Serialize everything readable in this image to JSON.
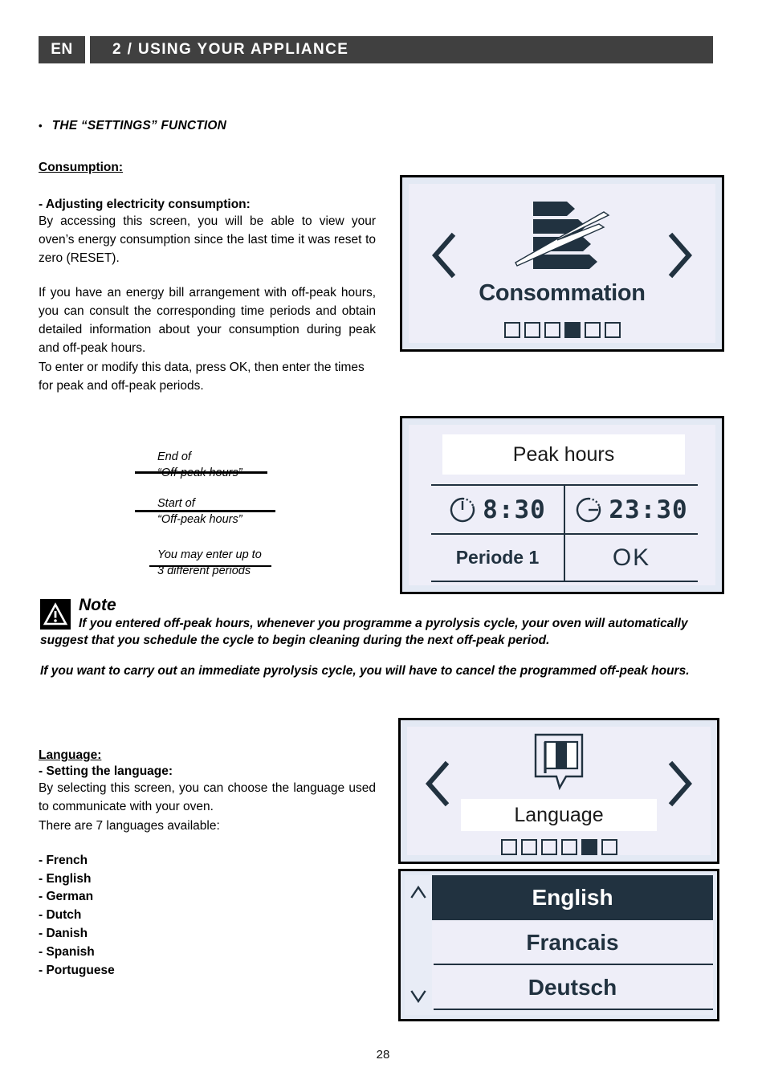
{
  "header": {
    "language_code": "EN",
    "chapter": "2 / USING YOUR APPLIANCE"
  },
  "left_column": {
    "section_bullet": "•",
    "section_title": "THE “SETTINGS” FUNCTION",
    "consumption_heading": "Consumption:",
    "consumption_subheading": "- Adjusting electricity consumption:",
    "consumption_para1": "By accessing this screen, you will be able to view your oven’s energy consumption since the last time it was reset to zero (RESET).",
    "consumption_para2": "If you have an energy bill arrangement with off-peak hours, you can consult the corresponding time periods and obtain detailed information about your consumption during peak and off-peak hours.",
    "consumption_para3": "To enter or modify this data,  press OK, then enter the times for peak and off-peak periods."
  },
  "callouts": [
    {
      "id": "end-off-peak",
      "text": "End of\n“Off-peak hours”"
    },
    {
      "id": "start-off-peak",
      "text": "Start of\n“Off-peak hours”"
    },
    {
      "id": "periods-note",
      "text": "You may enter up to\n3 different periods"
    }
  ],
  "panel_consumption": {
    "icon": "energy-bars-lightning-icon",
    "title": "Consommation",
    "prev_icon": "chevron-left-icon",
    "next_icon": "chevron-right-icon",
    "page_dots": [
      false,
      false,
      false,
      true,
      false,
      false
    ]
  },
  "panel_peak": {
    "title": "Peak hours",
    "start_clock_icon": "clock-start-icon",
    "start_time": "8:30",
    "end_clock_icon": "clock-end-icon",
    "end_time": "23:30",
    "period_label": "Periode 1",
    "ok_label": "OK"
  },
  "note": {
    "icon": "warning-triangle-icon",
    "title": "Note",
    "body1": "If you entered off-peak hours, whenever you programme a pyrolysis cycle, your oven will automatically suggest that you schedule the cycle to begin cleaning during the next off-peak period.",
    "body2": "If you want to carry out an immediate pyrolysis cycle, you will have to cancel the programmed off-peak hours."
  },
  "language_column": {
    "heading": "Language:",
    "subheading": "- Setting the language:",
    "para1": "By selecting this screen, you can choose the language used to communicate with your oven.",
    "para2": "There are 7 languages available:",
    "languages": "- French\n- English\n- German\n- Dutch\n- Danish\n- Spanish\n- Portuguese"
  },
  "panel_language": {
    "icon": "flag-speech-bubble-icon",
    "title": "Language",
    "prev_icon": "chevron-left-icon",
    "next_icon": "chevron-right-icon",
    "page_dots": [
      false,
      false,
      false,
      false,
      true,
      false
    ]
  },
  "panel_language_list": {
    "scroll_up_icon": "chevron-up-icon",
    "scroll_down_icon": "chevron-down-icon",
    "items": [
      {
        "label": "English",
        "selected": true
      },
      {
        "label": "Francais",
        "selected": false
      },
      {
        "label": "Deutsch",
        "selected": false
      }
    ]
  },
  "footer": {
    "page_number": "28"
  },
  "colors": {
    "header_bar": "#404040",
    "lcd_dark": "#213240",
    "panel_frame": "#e3e9f4",
    "panel_screen": "#eeeef8",
    "white": "#ffffff"
  }
}
